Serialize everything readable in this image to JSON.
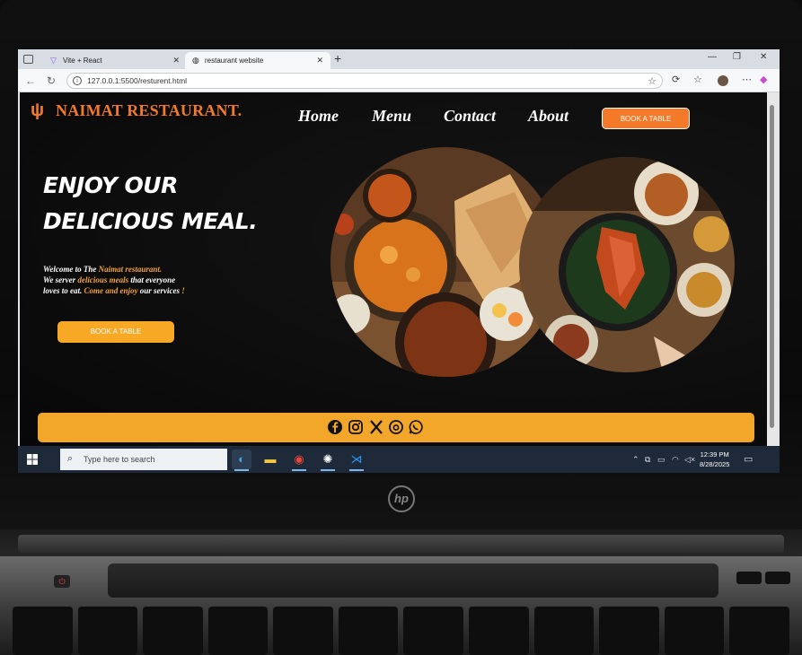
{
  "browser": {
    "tabs": [
      {
        "label": "Vite + React",
        "icon": "vite-icon"
      },
      {
        "label": "restaurant website",
        "icon": "globe-icon"
      }
    ],
    "url": "127.0.0.1:5500/resturent.html"
  },
  "site": {
    "logo": "NAIMAT RESTAURANT.",
    "nav": [
      "Home",
      "Menu",
      "Contact",
      "About"
    ],
    "nav_cta": "BOOK A TABLE",
    "headline": [
      "ENJOY OUR",
      "DELICIOUS MEAL."
    ],
    "welcome": {
      "p1": "Welcome to The ",
      "p2": "Naimat restaurant.",
      "p3": "We server ",
      "p4": "delicious meals",
      "p5": " that everyone",
      "p6": "loves to eat. ",
      "p7": "Come and enjoy",
      "p8": " our services ",
      "p9": "!"
    },
    "hero_cta": "BOOK A TABLE",
    "social_icons": [
      "facebook-icon",
      "instagram-icon",
      "x-icon",
      "threads-icon",
      "whatsapp-icon"
    ]
  },
  "taskbar": {
    "search_placeholder": "Type here to search",
    "apps": [
      "edge-icon",
      "file-explorer-icon",
      "chrome-icon",
      "chatgpt-icon",
      "vscode-icon"
    ],
    "time": "12:39 PM",
    "date": "8/28/2025"
  },
  "laptop": {
    "brand": "hp"
  },
  "colors": {
    "accent_orange": "#f47a2a",
    "footer_yellow": "#f2a72a",
    "site_bg": "#0a0a0a",
    "taskbar": "#1e2a3a"
  }
}
